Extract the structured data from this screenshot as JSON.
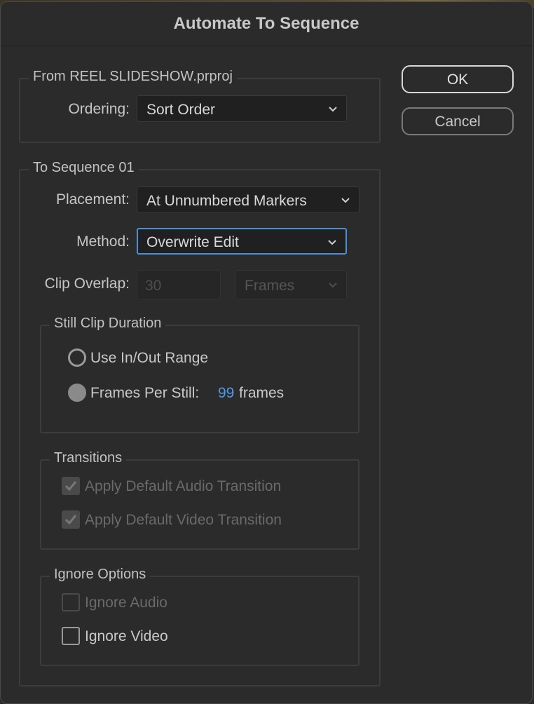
{
  "dialog": {
    "title": "Automate To Sequence"
  },
  "from_group": {
    "legend": "From REEL SLIDESHOW.prproj",
    "ordering_label": "Ordering:",
    "ordering_value": "Sort Order"
  },
  "to_group": {
    "legend": "To Sequence 01",
    "placement_label": "Placement:",
    "placement_value": "At Unnumbered Markers",
    "method_label": "Method:",
    "method_value": "Overwrite Edit",
    "clip_overlap_label": "Clip Overlap:",
    "clip_overlap_value": "30",
    "clip_overlap_unit": "Frames"
  },
  "still_clip": {
    "legend": "Still Clip Duration",
    "use_inout_label": "Use In/Out Range",
    "frames_per_still_label": "Frames Per Still:",
    "frames_value": "99",
    "frames_unit": "frames",
    "selected": "frames_per_still"
  },
  "transitions": {
    "legend": "Transitions",
    "audio_label": "Apply Default Audio Transition",
    "video_label": "Apply Default Video Transition",
    "audio_checked": true,
    "video_checked": true
  },
  "ignore": {
    "legend": "Ignore Options",
    "audio_label": "Ignore Audio",
    "video_label": "Ignore Video",
    "audio_checked": false,
    "video_checked": false
  },
  "buttons": {
    "ok": "OK",
    "cancel": "Cancel"
  },
  "colors": {
    "focus": "#4d8fd6",
    "accent_value": "#4e9be8",
    "background": "#2b2b2b"
  }
}
